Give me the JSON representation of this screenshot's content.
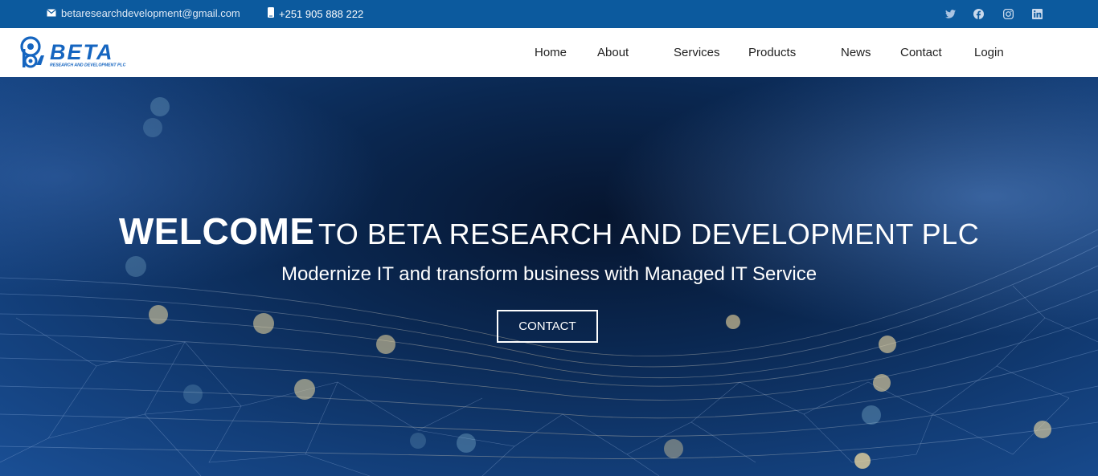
{
  "topbar": {
    "email": "betaresearchdevelopment@gmail.com",
    "phone": "+251 905 888 222",
    "social": [
      "twitter-icon",
      "facebook-icon",
      "instagram-icon",
      "linkedin-icon"
    ]
  },
  "logo": {
    "brand": "BETA",
    "tagline": "RESEARCH AND DEVELOPMENT PLC"
  },
  "nav": {
    "home": "Home",
    "about": "About",
    "services": "Services",
    "products": "Products",
    "news": "News",
    "contact": "Contact",
    "login": "Login"
  },
  "hero": {
    "title_big": "WELCOME",
    "title_rest": "TO BETA RESEARCH AND DEVELOPMENT PLC",
    "subtitle": "Modernize IT and transform business with Managed IT Service",
    "button": "CONTACT"
  },
  "colors": {
    "topbar": "#0c5a9e",
    "brand": "#1565c0",
    "hero_dark": "#06152f"
  }
}
